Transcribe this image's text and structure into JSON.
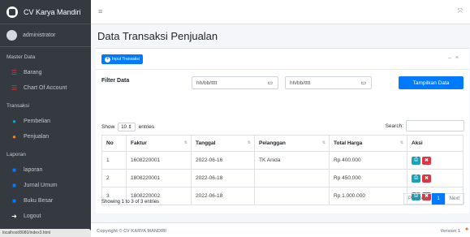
{
  "app": {
    "brand": "CV Karya Mandiri",
    "user": "administrator"
  },
  "sidebar": {
    "sections": [
      {
        "header": "Master Data",
        "items": [
          {
            "label": "Barang",
            "icon": "list-icon",
            "color": "#dc3545"
          },
          {
            "label": "Chart Of Account",
            "icon": "list-icon",
            "color": "#dc3545"
          }
        ]
      },
      {
        "header": "Transaksi",
        "items": [
          {
            "label": "Pembelian",
            "icon": "circle-icon",
            "color": "#17a2b8"
          },
          {
            "label": "Penjualan",
            "icon": "circle-icon",
            "color": "#fd7e14"
          }
        ]
      },
      {
        "header": "Laporan",
        "items": [
          {
            "label": "laporan",
            "icon": "file-icon",
            "color": "#007bff"
          },
          {
            "label": "Jurnal Umum",
            "icon": "file-icon",
            "color": "#007bff"
          },
          {
            "label": "Buku Besar",
            "icon": "file-icon",
            "color": "#007bff"
          },
          {
            "label": "Logout",
            "icon": "logout-icon",
            "color": "#ffffff"
          }
        ]
      }
    ]
  },
  "statusbar": "localhost/8080/index3.html",
  "page": {
    "title": "Data Transaksi Penjualan"
  },
  "card": {
    "input_button": "Input Transaksi",
    "filter_label": "Filter Data",
    "date_from_placeholder": "hh/bb/tttt",
    "date_to_placeholder": "hh/bb/tttt",
    "show_button": "Tampilkan Data",
    "show_prefix": "Show",
    "show_value": "10",
    "show_suffix": "entries",
    "search_label": "Search:",
    "columns": [
      "No",
      "Faktur",
      "Tanggal",
      "Pelanggan",
      "Total Harga",
      "Aksi"
    ],
    "rows": [
      {
        "no": "1",
        "faktur": "1608220001",
        "tanggal": "2022-06-16",
        "pelanggan": "TK Anida",
        "total": "Rp 400.000"
      },
      {
        "no": "2",
        "faktur": "1808220001",
        "tanggal": "2022-06-18",
        "pelanggan": "",
        "total": "Rp 450.000"
      },
      {
        "no": "3",
        "faktur": "1808220002",
        "tanggal": "2022-06-18",
        "pelanggan": "",
        "total": "Rp 1.000.000"
      }
    ],
    "info": "Showing 1 to 3 of 3 entries",
    "pager": {
      "previous": "Previous",
      "current": "1",
      "next": "Next"
    }
  },
  "footer": {
    "copyright": "Copyright © CV KARYA MANDIRI",
    "version": "Version 1"
  }
}
